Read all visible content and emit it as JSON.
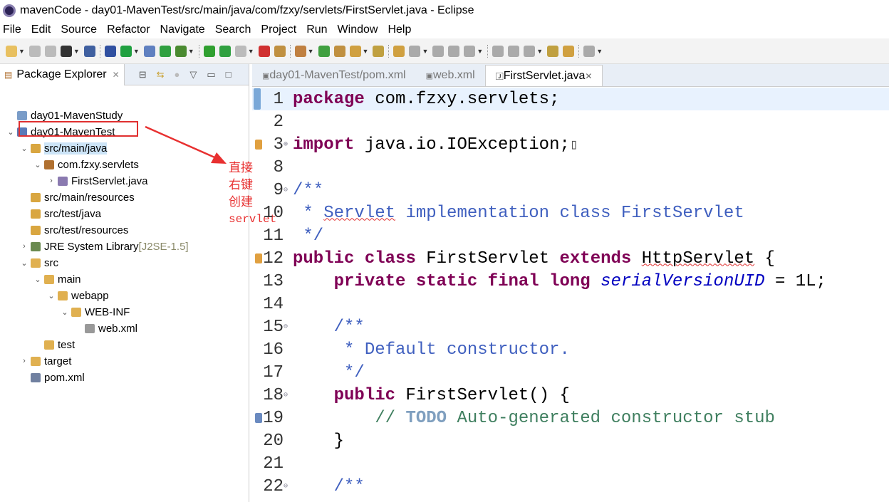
{
  "window": {
    "title": "mavenCode - day01-MavenTest/src/main/java/com/fzxy/servlets/FirstServlet.java - Eclipse"
  },
  "menu": [
    "File",
    "Edit",
    "Source",
    "Refactor",
    "Navigate",
    "Search",
    "Project",
    "Run",
    "Window",
    "Help"
  ],
  "package_explorer": {
    "title": "Package Explorer",
    "items": [
      {
        "label": "day01-MavenStudy",
        "depth": 0,
        "twisty": "",
        "icon": "project-folder-icon",
        "color": "#7a9cc8"
      },
      {
        "label": "day01-MavenTest",
        "depth": 0,
        "twisty": "open",
        "icon": "maven-project-icon",
        "color": "#5a7ab8"
      },
      {
        "label": "src/main/java",
        "depth": 1,
        "twisty": "open",
        "icon": "source-folder-error-icon",
        "color": "#d9a640",
        "selected": true
      },
      {
        "label": "com.fzxy.servlets",
        "depth": 2,
        "twisty": "open",
        "icon": "package-error-icon",
        "color": "#b07030"
      },
      {
        "label": "FirstServlet.java",
        "depth": 3,
        "twisty": "closed",
        "icon": "java-file-error-icon",
        "color": "#8a7ab0"
      },
      {
        "label": "src/main/resources",
        "depth": 1,
        "twisty": "",
        "icon": "source-folder-icon",
        "color": "#d9a640"
      },
      {
        "label": "src/test/java",
        "depth": 1,
        "twisty": "",
        "icon": "source-folder-icon",
        "color": "#d9a640"
      },
      {
        "label": "src/test/resources",
        "depth": 1,
        "twisty": "",
        "icon": "source-folder-icon",
        "color": "#d9a640"
      },
      {
        "label": "JRE System Library",
        "suffix": "[J2SE-1.5]",
        "depth": 1,
        "twisty": "closed",
        "icon": "library-icon",
        "color": "#6a8a50"
      },
      {
        "label": "src",
        "depth": 1,
        "twisty": "open",
        "icon": "folder-error-icon",
        "color": "#e0b050"
      },
      {
        "label": "main",
        "depth": 2,
        "twisty": "open",
        "icon": "folder-open-icon",
        "color": "#e0b050"
      },
      {
        "label": "webapp",
        "depth": 3,
        "twisty": "open",
        "icon": "folder-open-icon",
        "color": "#e0b050"
      },
      {
        "label": "WEB-INF",
        "depth": 4,
        "twisty": "open",
        "icon": "folder-open-icon",
        "color": "#e0b050"
      },
      {
        "label": "web.xml",
        "depth": 5,
        "twisty": "",
        "icon": "xml-file-icon",
        "color": "#999"
      },
      {
        "label": "test",
        "depth": 2,
        "twisty": "",
        "icon": "folder-icon",
        "color": "#e0b050"
      },
      {
        "label": "target",
        "depth": 1,
        "twisty": "closed",
        "icon": "folder-icon",
        "color": "#e0b050"
      },
      {
        "label": "pom.xml",
        "depth": 1,
        "twisty": "",
        "icon": "maven-pom-icon",
        "color": "#7080a0"
      }
    ]
  },
  "annotation": {
    "lines": [
      "直接",
      "右键",
      "创建",
      "servlet"
    ],
    "color": "#e83030"
  },
  "editor": {
    "tabs": [
      {
        "label": "day01-MavenTest/pom.xml",
        "active": false
      },
      {
        "label": "web.xml",
        "active": false
      },
      {
        "label": "FirstServlet.java",
        "active": true
      }
    ],
    "lines": [
      {
        "n": "1",
        "tokens": [
          [
            "package",
            "kw"
          ],
          [
            " com.fzxy.servlets;",
            ""
          ]
        ],
        "current": true
      },
      {
        "n": "2",
        "tokens": []
      },
      {
        "n": "3",
        "fold": "+",
        "marker": "error",
        "tokens": [
          [
            "import",
            "kw"
          ],
          [
            " java.io.IOException;",
            ""
          ],
          [
            "▯",
            ""
          ]
        ]
      },
      {
        "n": "8",
        "tokens": []
      },
      {
        "n": "9",
        "fold": "-",
        "tokens": [
          [
            "/**",
            "jd"
          ]
        ]
      },
      {
        "n": "10",
        "tokens": [
          [
            " * ",
            "jd"
          ],
          [
            "Servlet",
            "jd sq"
          ],
          [
            " implementation class FirstServlet",
            "jd"
          ]
        ]
      },
      {
        "n": "11",
        "tokens": [
          [
            " */",
            "jd"
          ]
        ]
      },
      {
        "n": "12",
        "marker": "error",
        "tokens": [
          [
            "public",
            "kw"
          ],
          [
            " ",
            ""
          ],
          [
            "class",
            "kw"
          ],
          [
            " FirstServlet ",
            ""
          ],
          [
            "extends",
            "kw"
          ],
          [
            " ",
            ""
          ],
          [
            "HttpServlet",
            "sq"
          ],
          [
            " {",
            ""
          ]
        ]
      },
      {
        "n": "13",
        "tokens": [
          [
            "    ",
            ""
          ],
          [
            "private",
            "kw"
          ],
          [
            " ",
            ""
          ],
          [
            "static",
            "kw"
          ],
          [
            " ",
            ""
          ],
          [
            "final",
            "kw"
          ],
          [
            " ",
            ""
          ],
          [
            "long",
            "kw"
          ],
          [
            " ",
            ""
          ],
          [
            "serialVersionUID",
            "fld"
          ],
          [
            " = 1L;",
            ""
          ]
        ]
      },
      {
        "n": "14",
        "tokens": []
      },
      {
        "n": "15",
        "fold": "-",
        "tokens": [
          [
            "    /**",
            "jd"
          ]
        ]
      },
      {
        "n": "16",
        "tokens": [
          [
            "     * Default constructor.",
            "jd"
          ]
        ]
      },
      {
        "n": "17",
        "tokens": [
          [
            "     */",
            "jd"
          ]
        ]
      },
      {
        "n": "18",
        "fold": "-",
        "tokens": [
          [
            "    ",
            ""
          ],
          [
            "public",
            "kw"
          ],
          [
            " FirstServlet() {",
            ""
          ]
        ]
      },
      {
        "n": "19",
        "marker": "task",
        "tokens": [
          [
            "        // ",
            "cm"
          ],
          [
            "TODO",
            "todo"
          ],
          [
            " Auto-generated constructor stub",
            "cm"
          ]
        ]
      },
      {
        "n": "20",
        "tokens": [
          [
            "    }",
            ""
          ]
        ]
      },
      {
        "n": "21",
        "tokens": []
      },
      {
        "n": "22",
        "fold": "-",
        "tokens": [
          [
            "    /**",
            "jd"
          ]
        ]
      }
    ]
  },
  "colors": {
    "keyword": "#7f0055",
    "javadoc": "#3f5fbf",
    "comment": "#3f7f5f",
    "selection": "#cce4f7",
    "annotation_red": "#e03030"
  }
}
